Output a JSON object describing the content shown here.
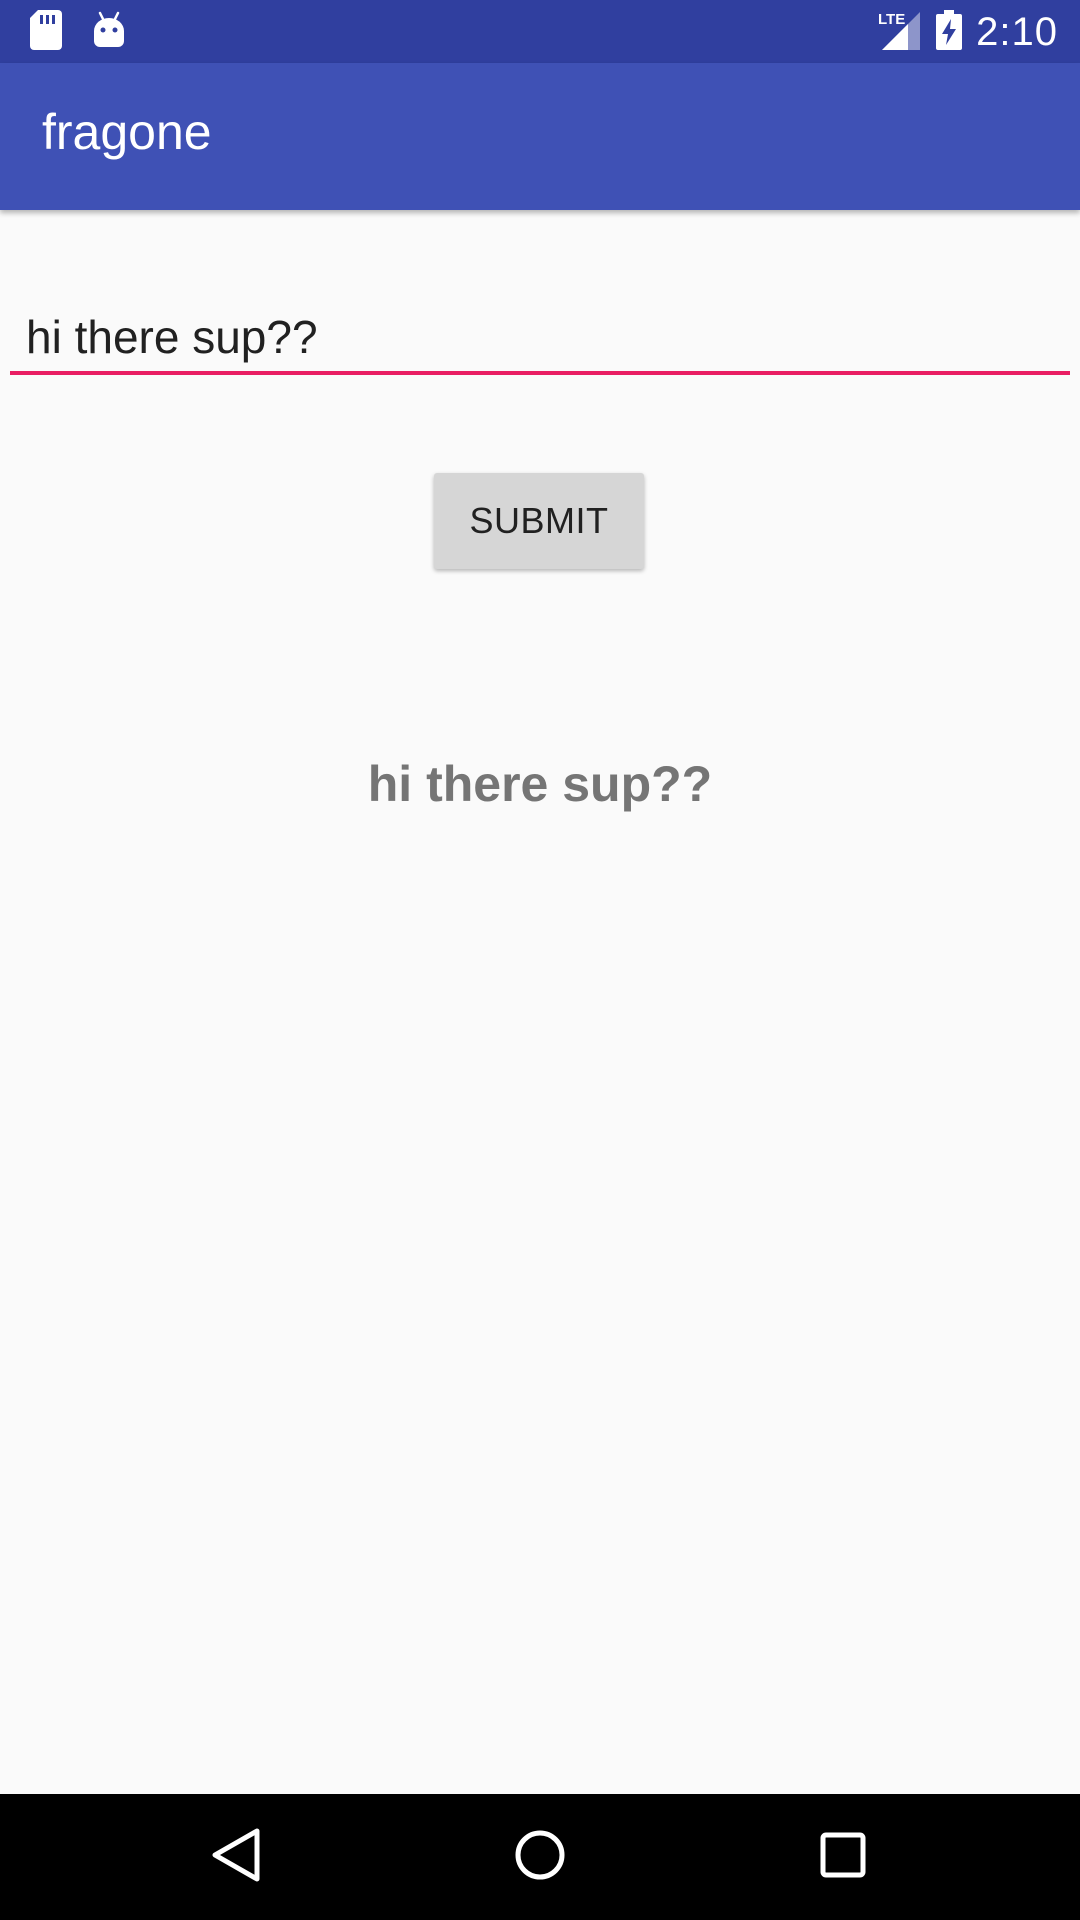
{
  "status_bar": {
    "time": "2:10",
    "network_label": "LTE",
    "icons": [
      "sd-card-icon",
      "android-icon",
      "lte-signal-icon",
      "battery-charging-icon"
    ]
  },
  "app_bar": {
    "title": "fragone"
  },
  "form": {
    "input_value": "hi there sup??",
    "submit_label": "SUBMIT"
  },
  "output": {
    "text": "hi there sup??"
  },
  "nav_bar": {
    "icons": [
      "back-icon",
      "home-icon",
      "recents-icon"
    ]
  },
  "colors": {
    "status_bar": "#303f9f",
    "app_bar": "#3f51b5",
    "accent": "#e91e63",
    "background": "#fafafa",
    "button": "#d6d6d6",
    "output_text": "#757575"
  }
}
